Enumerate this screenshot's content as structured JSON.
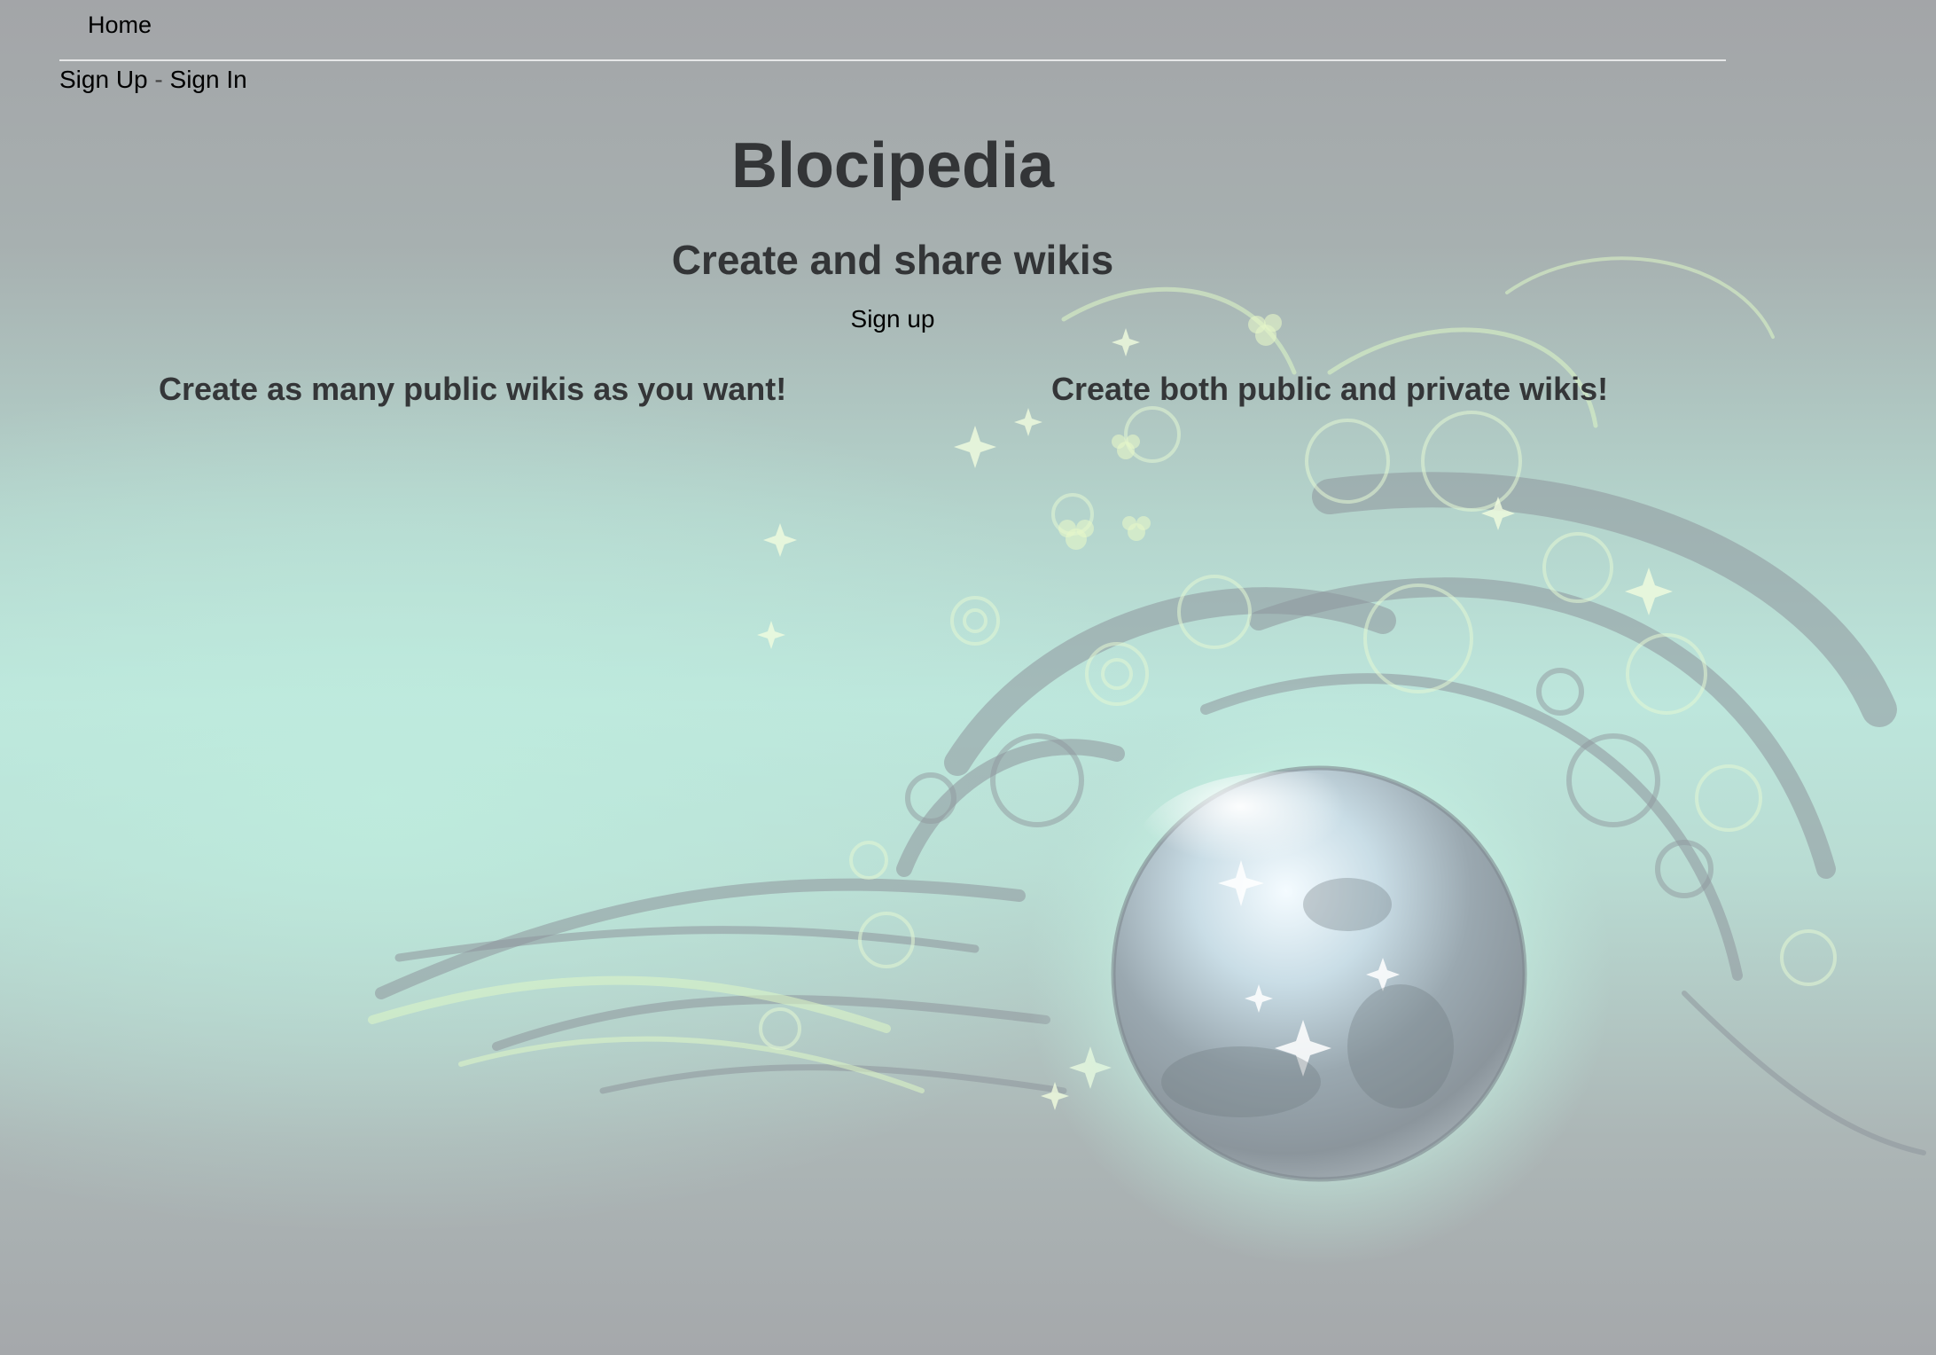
{
  "nav": {
    "home_label": "Home",
    "sign_up_label": "Sign Up",
    "separator": "-",
    "sign_in_label": "Sign In"
  },
  "hero": {
    "title": "Blocipedia",
    "tagline": "Create and share wikis",
    "signup_link": "Sign up"
  },
  "features": {
    "left": "Create as many public wikis as you want!",
    "right": "Create both public and private wikis!"
  },
  "colors": {
    "heading": "#333537",
    "link": "#000000",
    "background_mint": "#bde6dc",
    "background_gray": "#a3a5a8"
  },
  "background": {
    "art_name": "swirl-orb-artwork"
  }
}
